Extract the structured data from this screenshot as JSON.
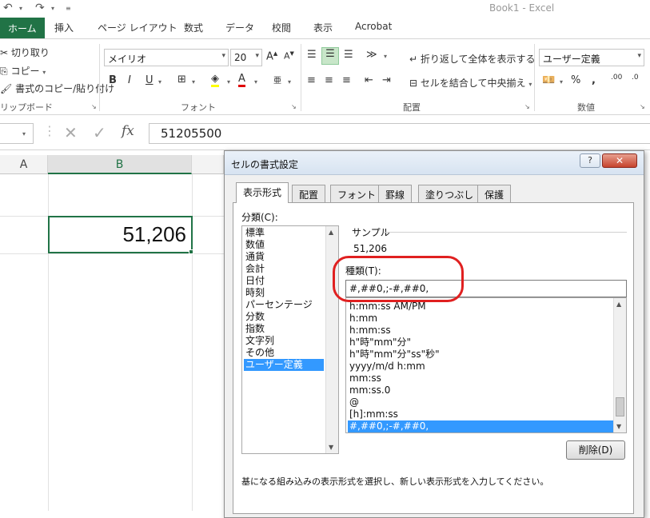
{
  "app": {
    "title": "Book1 - Excel"
  },
  "qat": {
    "undo_icon": "undo-icon",
    "redo_icon": "redo-icon"
  },
  "tabs": [
    "ホーム",
    "挿入",
    "ページ レイアウト",
    "数式",
    "データ",
    "校閲",
    "表示",
    "Acrobat"
  ],
  "ribbon": {
    "clipboard": {
      "cut": "切り取り",
      "copy": "コピー",
      "format_painter": "書式のコピー/貼り付け",
      "label": "リップボード"
    },
    "font": {
      "name": "メイリオ",
      "size": "20",
      "bold": "B",
      "italic": "I",
      "underline": "U",
      "label": "フォント"
    },
    "alignment": {
      "wrap": "折り返して全体を表示する",
      "merge": "セルを結合して中央揃え",
      "label": "配置"
    },
    "number": {
      "format": "ユーザー定義",
      "percent": "%",
      "comma": ",",
      "label": "数値"
    }
  },
  "formula_bar": {
    "value": "51205500",
    "fx": "fx"
  },
  "sheet": {
    "columns": [
      "A",
      "B"
    ],
    "selected_cell_value": "51,206"
  },
  "dialog": {
    "title": "セルの書式設定",
    "help": "?",
    "tabs": [
      "表示形式",
      "配置",
      "フォント",
      "罫線",
      "塗りつぶし",
      "保護"
    ],
    "category_label": "分類(C):",
    "categories": [
      "標準",
      "数値",
      "通貨",
      "会計",
      "日付",
      "時刻",
      "パーセンテージ",
      "分数",
      "指数",
      "文字列",
      "その他",
      "ユーザー定義"
    ],
    "selected_category_index": 11,
    "sample_label": "サンプル",
    "sample_value": "51,206",
    "type_label": "種類(T):",
    "type_value": "#,##0,;-#,##0,",
    "formats": [
      "h:mm:ss AM/PM",
      "h:mm",
      "h:mm:ss",
      "h\"時\"mm\"分\"",
      "h\"時\"mm\"分\"ss\"秒\"",
      "yyyy/m/d h:mm",
      "mm:ss",
      "mm:ss.0",
      "@",
      "[h]:mm:ss",
      "#,##0,;-#,##0,"
    ],
    "selected_format_index": 10,
    "delete_button": "削除(D)",
    "description": "基になる組み込みの表示形式を選択し、新しい表示形式を入力してください。"
  },
  "colors": {
    "excel_green": "#217346",
    "highlight": "#3399ff",
    "annotation_red": "#e02020"
  }
}
